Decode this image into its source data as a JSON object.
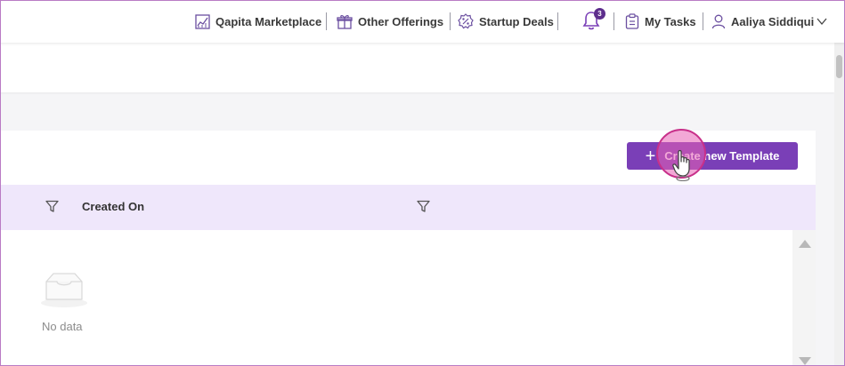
{
  "header": {
    "nav": [
      {
        "label": "Qapita Marketplace",
        "icon": "chart-icon"
      },
      {
        "label": "Other Offerings",
        "icon": "gift-icon"
      },
      {
        "label": "Startup Deals",
        "icon": "percent-badge-icon"
      }
    ],
    "notifications": {
      "count": "3",
      "icon": "bell-icon"
    },
    "tasks": {
      "label": "My Tasks",
      "icon": "clipboard-icon"
    },
    "user": {
      "name": "Aaliya Siddiqui",
      "icon": "user-icon"
    }
  },
  "toolbar": {
    "create_button_label": "Create new Template"
  },
  "table": {
    "columns": [
      {
        "label": ""
      },
      {
        "label": "Created On"
      }
    ],
    "empty_text": "No data"
  },
  "colors": {
    "accent": "#7a3fb7",
    "header_row": "#efe7fb",
    "badge": "#5d2e8c",
    "click_indicator": "#e860b4"
  }
}
